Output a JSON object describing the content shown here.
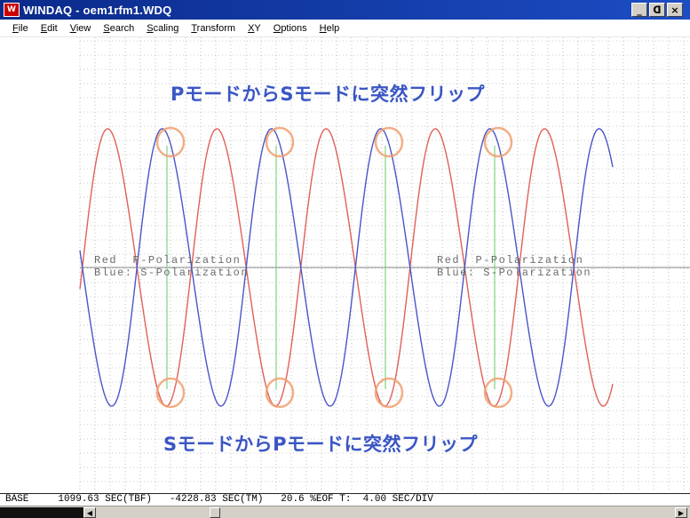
{
  "window": {
    "icon": "windaq-app-icon",
    "title": "WINDAQ - oem1rfm1.WDQ",
    "controls": {
      "minimize": "_",
      "restore": "ᗡ",
      "close": "×"
    }
  },
  "menu": [
    {
      "acc": "F",
      "rest": "ile"
    },
    {
      "acc": "E",
      "rest": "dit"
    },
    {
      "acc": "V",
      "rest": "iew"
    },
    {
      "acc": "S",
      "rest": "earch"
    },
    {
      "acc": "S",
      "rest": "caling"
    },
    {
      "acc": "T",
      "rest": "ransform"
    },
    {
      "acc": "X",
      "rest": "Y"
    },
    {
      "acc": "O",
      "rest": "ptions"
    },
    {
      "acc": "H",
      "rest": "elp"
    }
  ],
  "plot": {
    "annotation_top": "PモードからSモードに突然フリップ",
    "annotation_bottom": "SモードからPモードに突然フリップ",
    "legend_left": {
      "line1": "Red  P-Polarization",
      "line2": "Blue: S-Polarization"
    },
    "legend_right": {
      "line1": "Red  P-Polarization",
      "line2": "Blue: S-Polarization"
    },
    "colors": {
      "red_trace": "#e0605a",
      "blue_trace": "#4a55c8",
      "green_marker": "#7fd27f",
      "circle": "#f0a070",
      "grid": "#9a9a9a",
      "annotation": "#3a56c4"
    }
  },
  "status": {
    "text": "BASE     1099.63 SEC(TBF)   -4228.83 SEC(TM)   20.6 %EOF T:  4.00 SEC/DIV"
  },
  "scrollbar": {
    "left_arrow": "◀",
    "right_arrow": "▶"
  }
}
